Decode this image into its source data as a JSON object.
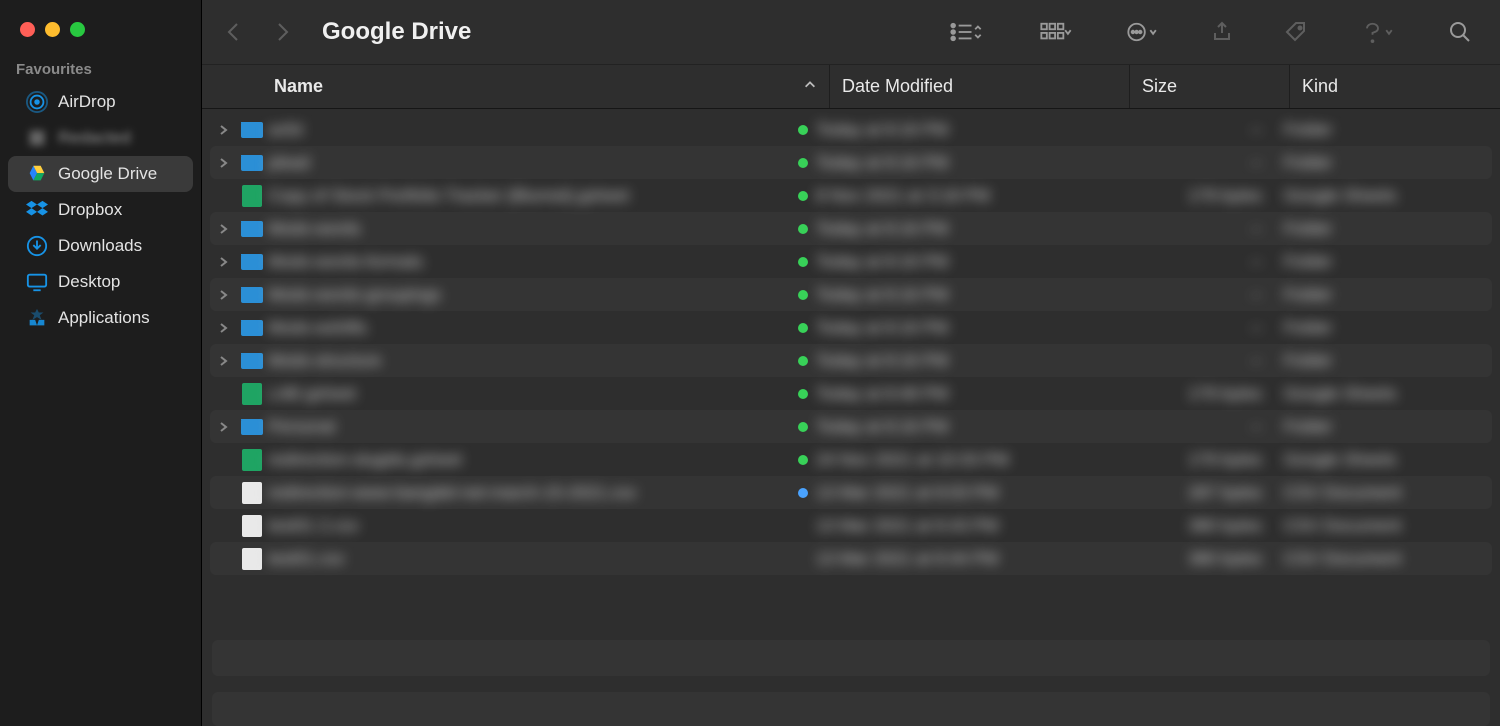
{
  "window": {
    "title": "Google Drive"
  },
  "sidebar": {
    "heading": "Favourites",
    "items": [
      {
        "label": "AirDrop",
        "icon": "airdrop",
        "active": false,
        "dim": false
      },
      {
        "label": "Redacted",
        "icon": "generic",
        "active": false,
        "dim": true
      },
      {
        "label": "Google Drive",
        "icon": "gdrive",
        "active": true,
        "dim": false
      },
      {
        "label": "Dropbox",
        "icon": "dropbox",
        "active": false,
        "dim": false
      },
      {
        "label": "Downloads",
        "icon": "downloads",
        "active": false,
        "dim": false
      },
      {
        "label": "Desktop",
        "icon": "desktop",
        "active": false,
        "dim": false
      },
      {
        "label": "Applications",
        "icon": "apps",
        "active": false,
        "dim": false
      }
    ]
  },
  "columns": {
    "name": "Name",
    "date": "Date Modified",
    "size": "Size",
    "kind": "Kind"
  },
  "files": [
    {
      "icon": "folder",
      "expand": true,
      "name": "axfsl",
      "sync": "ok",
      "date": "Today at 8:16 PM",
      "size": "--",
      "kind": "Folder"
    },
    {
      "icon": "folder",
      "expand": true,
      "name": "plead",
      "sync": "ok",
      "date": "Today at 8:16 PM",
      "size": "--",
      "kind": "Folder"
    },
    {
      "icon": "sheet",
      "expand": false,
      "name": "Copy of Stock Portfolio Tracker (Blurred).gsheet",
      "sync": "ok",
      "date": "8 Nov 2021 at 3:18 PM",
      "size": "179 bytes",
      "kind": "Google Sheets"
    },
    {
      "icon": "folder",
      "expand": true,
      "name": "Mods-words",
      "sync": "ok",
      "date": "Today at 8:16 PM",
      "size": "--",
      "kind": "Folder"
    },
    {
      "icon": "folder",
      "expand": true,
      "name": "Mods-words-formats",
      "sync": "ok",
      "date": "Today at 8:16 PM",
      "size": "--",
      "kind": "Folder"
    },
    {
      "icon": "folder",
      "expand": true,
      "name": "Mods-words-groupings",
      "sync": "ok",
      "date": "Today at 8:16 PM",
      "size": "--",
      "kind": "Folder"
    },
    {
      "icon": "folder",
      "expand": true,
      "name": "Mods-wshifts",
      "sync": "ok",
      "date": "Today at 8:16 PM",
      "size": "--",
      "kind": "Folder"
    },
    {
      "icon": "folder",
      "expand": true,
      "name": "Mods-structure",
      "sync": "ok",
      "date": "Today at 8:16 PM",
      "size": "--",
      "kind": "Folder"
    },
    {
      "icon": "sheet",
      "expand": false,
      "name": "LAB gsheet",
      "sync": "ok",
      "date": "Today at 8:48 PM",
      "size": "179 bytes",
      "kind": "Google Sheets"
    },
    {
      "icon": "folder",
      "expand": true,
      "name": "Personal",
      "sync": "ok",
      "date": "Today at 8:16 PM",
      "size": "--",
      "kind": "Folder"
    },
    {
      "icon": "sheet",
      "expand": false,
      "name": "redirection-slugids.gsheet",
      "sync": "ok",
      "date": "24 Nov 2021 at 10:33 PM",
      "size": "179 bytes",
      "kind": "Google Sheets"
    },
    {
      "icon": "doc",
      "expand": false,
      "name": "redirection-www-bangdel-net-march-15-2021.csv",
      "sync": "down",
      "date": "13 Mar 2021 at 6:03 PM",
      "size": "287 bytes",
      "kind": "CSV Document"
    },
    {
      "icon": "doc",
      "expand": false,
      "name": "test01 2.csv",
      "sync": "",
      "date": "13 Mar 2021 at 6:43 PM",
      "size": "380 bytes",
      "kind": "CSV Document"
    },
    {
      "icon": "doc",
      "expand": false,
      "name": "test01.csv",
      "sync": "",
      "date": "13 Mar 2021 at 6:44 PM",
      "size": "380 bytes",
      "kind": "CSV Document"
    }
  ]
}
